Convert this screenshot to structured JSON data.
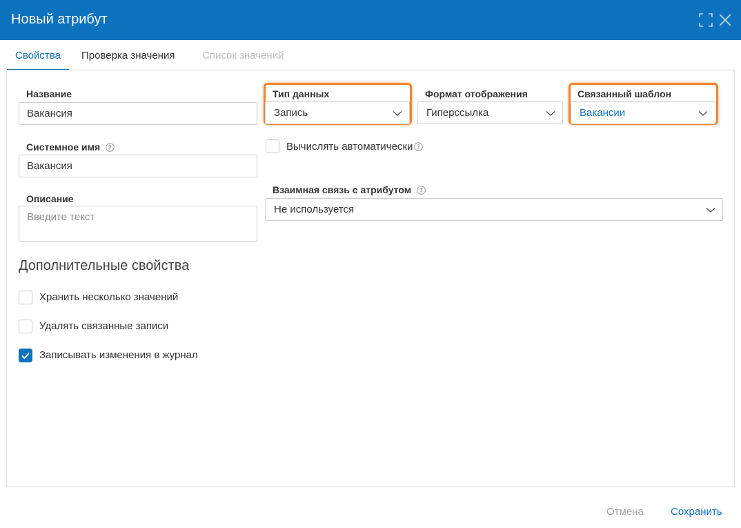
{
  "dialog": {
    "title": "Новый атрибут"
  },
  "tabs": [
    {
      "label": "Свойства",
      "state": "active"
    },
    {
      "label": "Проверка значения",
      "state": "normal"
    },
    {
      "label": "Список значений",
      "state": "disabled"
    }
  ],
  "fields": {
    "name": {
      "label": "Название",
      "value": "Вакансия"
    },
    "system_name": {
      "label": "Системное имя",
      "value": "Вакансия"
    },
    "description": {
      "label": "Описание",
      "placeholder": "Введите текст"
    },
    "data_type": {
      "label": "Тип данных",
      "value": "Запись"
    },
    "display_format": {
      "label": "Формат отображения",
      "value": "Гиперссылка"
    },
    "linked_template": {
      "label": "Связанный шаблон",
      "value": "Вакансии"
    },
    "auto_compute": {
      "label": "Вычислять автоматически",
      "checked": false
    },
    "mutual_link": {
      "label": "Взаимная связь с атрибутом",
      "value": "Не используется"
    }
  },
  "additional": {
    "title": "Дополнительные свойства",
    "options": [
      {
        "label": "Хранить несколько значений",
        "checked": false
      },
      {
        "label": "Удалять связанные записи",
        "checked": false
      },
      {
        "label": "Записывать изменения в журнал",
        "checked": true
      }
    ]
  },
  "footer": {
    "cancel_label": "Отмена",
    "save_label": "Сохранить"
  },
  "colors": {
    "header_bg": "#0d72be",
    "accent": "#0d72be",
    "highlight": "#f0862f"
  }
}
